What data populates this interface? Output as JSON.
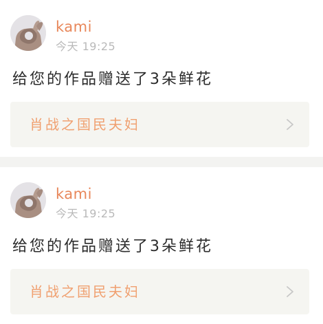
{
  "notifications": [
    {
      "username": "kami",
      "timestamp": "今天 19:25",
      "message": "给您的作品赠送了3朵鲜花",
      "work_title": "肖战之国民夫妇"
    },
    {
      "username": "kami",
      "timestamp": "今天 19:25",
      "message": "给您的作品赠送了3朵鲜花",
      "work_title": "肖战之国民夫妇"
    }
  ],
  "colors": {
    "username": "#e8875a",
    "work_title": "#f0a070",
    "timestamp": "#b9b9b9",
    "message": "#2b2b2b",
    "link_background": "#f5f5f1",
    "separator": "#f3f3f1"
  },
  "icons": {
    "avatar": "hand-ok-gesture-avatar",
    "chevron": "chevron-right-icon"
  }
}
